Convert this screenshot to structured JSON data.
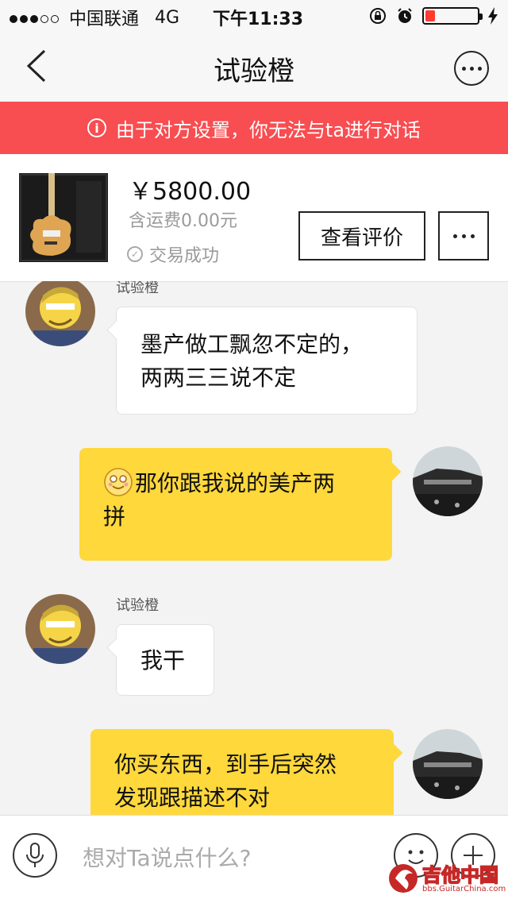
{
  "status_bar": {
    "carrier": "中国联通",
    "network": "4G",
    "time": "下午11:33"
  },
  "nav": {
    "title": "试验橙"
  },
  "banner": {
    "icon_glyph": "i",
    "text": "由于对方设置，你无法与ta进行对话",
    "color": "#f84d51"
  },
  "product": {
    "price": "￥5800.00",
    "shipping": "含运费0.00元",
    "status": "交易成功",
    "review_button": "查看评价"
  },
  "messages": [
    {
      "side": "in",
      "name": "试验橙",
      "text_lines": [
        "墨产做工飘忽不定的，",
        "两两三三说不定"
      ]
    },
    {
      "side": "out",
      "text_lines": [
        "那你跟我说的美产两",
        "拼"
      ],
      "emoji": "smiling-face"
    },
    {
      "side": "in",
      "name": "试验橙",
      "text_lines": [
        "我干"
      ]
    },
    {
      "side": "out",
      "text_lines": [
        "你买东西，到手后突然",
        "发现跟描述不对"
      ]
    }
  ],
  "input_bar": {
    "placeholder": "想对Ta说点什么?"
  },
  "watermark": {
    "text": "吉他中国",
    "url": "bbs.GuitarChina.com"
  },
  "colors": {
    "outgoing_bubble": "#ffd83c",
    "incoming_bubble": "#ffffff",
    "banner": "#f84d51"
  }
}
